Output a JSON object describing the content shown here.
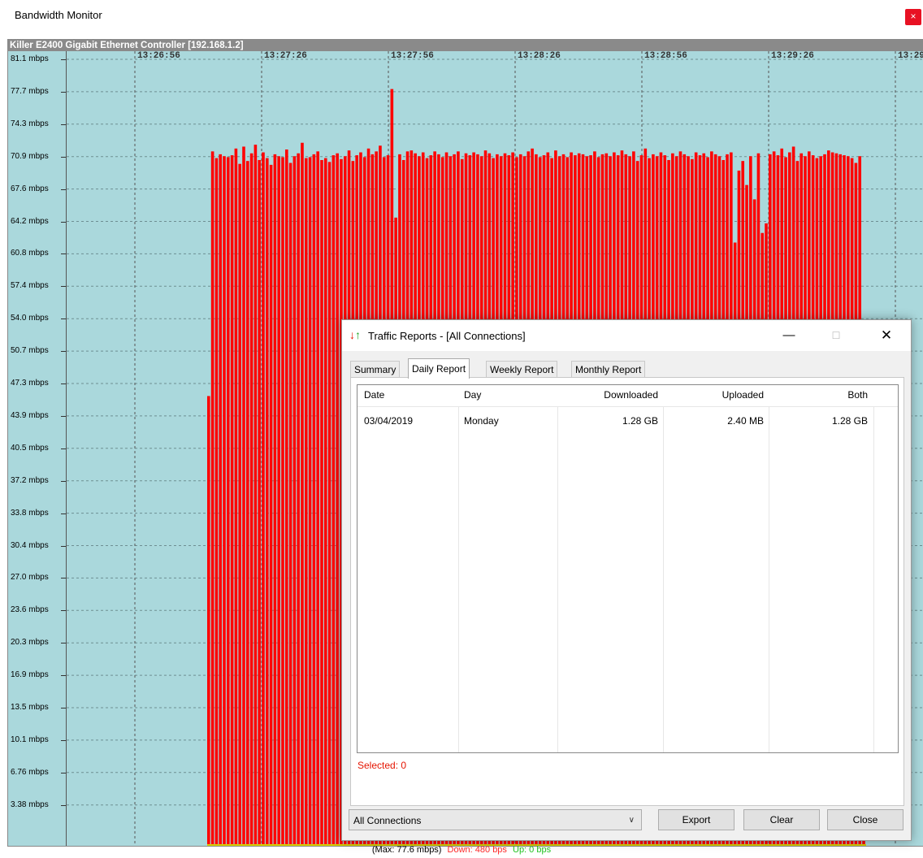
{
  "app": {
    "title": "Bandwidth Monitor",
    "close_glyph": "×"
  },
  "adapter": {
    "header": "Killer E2400 Gigabit Ethernet Controller [192.168.1.2]"
  },
  "footer": {
    "max": "(Max: 77.6 mbps)",
    "down": "Down: 480 bps",
    "up": "Up: 0 bps",
    "colors": {
      "down": "#ff2a2a",
      "up": "#22c422"
    }
  },
  "chart_data": {
    "type": "bar",
    "x_unit": "time",
    "x_tick_labels": [
      "13:26:56",
      "13:27:26",
      "13:27:56",
      "13:28:26",
      "13:28:56",
      "13:29:26",
      "13:29:"
    ],
    "y_tick_labels": [
      "81.1 mbps",
      "77.7 mbps",
      "74.3 mbps",
      "70.9 mbps",
      "67.6 mbps",
      "64.2 mbps",
      "60.8 mbps",
      "57.4 mbps",
      "54.0 mbps",
      "50.7 mbps",
      "47.3 mbps",
      "43.9 mbps",
      "40.5 mbps",
      "37.2 mbps",
      "33.8 mbps",
      "30.4 mbps",
      "27.0 mbps",
      "23.6 mbps",
      "20.3 mbps",
      "16.9 mbps",
      "13.5 mbps",
      "10.1 mbps",
      "6.76 mbps",
      "3.38 mbps"
    ],
    "ylim": [
      0,
      81.1
    ],
    "y_unit": "mbps",
    "grid": true,
    "bar_color": "#ff0000",
    "background": "#aad8dc",
    "series": [
      {
        "values": [
          46.0,
          71.5,
          70.8,
          71.2,
          71.0,
          70.9,
          71.1,
          71.8,
          70.2,
          72.0,
          70.5,
          71.3,
          72.2,
          70.6,
          71.4,
          70.8,
          70.1,
          71.2,
          71.0,
          70.9,
          71.7,
          70.3,
          71.0,
          71.3,
          72.4,
          70.8,
          70.9,
          71.2,
          71.5,
          70.6,
          70.8,
          70.4,
          71.1,
          71.3,
          70.7,
          71.0,
          71.6,
          70.5,
          71.1,
          71.4,
          70.9,
          71.8,
          71.2,
          71.5,
          72.1,
          70.9,
          71.1,
          78.0,
          64.6,
          71.2,
          70.6,
          71.5,
          71.6,
          71.3,
          71.0,
          71.4,
          70.8,
          71.1,
          71.5,
          71.2,
          70.9,
          71.4,
          71.0,
          71.2,
          71.5,
          70.7,
          71.3,
          71.1,
          71.4,
          71.2,
          71.0,
          71.6,
          71.3,
          70.8,
          71.2,
          71.0,
          71.3,
          71.1,
          71.4,
          70.9,
          71.2,
          71.0,
          71.5,
          71.8,
          71.2,
          70.9,
          71.1,
          71.4,
          70.8,
          71.6,
          71.0,
          71.2,
          70.9,
          71.4,
          71.1,
          71.3,
          71.2,
          71.0,
          71.1,
          71.5,
          70.9,
          71.2,
          71.3,
          71.0,
          71.4,
          71.1,
          71.6,
          71.2,
          71.0,
          71.5,
          70.5,
          71.1,
          71.8,
          70.8,
          71.2,
          71.0,
          71.4,
          71.1,
          70.6,
          71.3,
          71.0,
          71.5,
          71.2,
          71.0,
          70.7,
          71.4,
          71.1,
          71.3,
          70.9,
          71.5,
          71.2,
          71.0,
          70.6,
          71.2,
          71.4,
          62.0,
          69.5,
          70.5,
          68.0,
          71.0,
          66.5,
          71.3,
          63.0,
          64.0,
          71.2,
          71.5,
          71.1,
          71.8,
          70.9,
          71.4,
          72.0,
          70.5,
          71.3,
          71.0,
          71.5,
          71.1,
          70.8,
          71.0,
          71.2,
          71.6,
          71.4,
          71.3,
          71.2,
          71.1,
          71.0,
          70.8,
          70.3,
          71.0,
          1.0
        ]
      }
    ]
  },
  "dialog": {
    "title": "Traffic Reports - [All Connections]",
    "icon_down": "↓",
    "icon_up": "↑",
    "minimize": "—",
    "maximize": "☐",
    "close": "✕",
    "tabs": [
      "Summary",
      "Daily Report",
      "Weekly Report",
      "Monthly Report"
    ],
    "active_tab": "Daily Report",
    "columns": [
      "Date",
      "Day",
      "Downloaded",
      "Uploaded",
      "Both"
    ],
    "rows": [
      {
        "date": "03/04/2019",
        "day": "Monday",
        "downloaded": "1.28 GB",
        "uploaded": "2.40 MB",
        "both": "1.28 GB"
      }
    ],
    "selected": "Selected: 0",
    "connection_select": "All Connections",
    "buttons": {
      "export": "Export",
      "clear": "Clear",
      "close": "Close"
    }
  }
}
